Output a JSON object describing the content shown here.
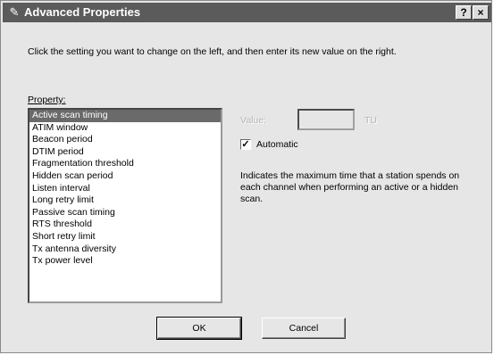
{
  "window": {
    "title": "Advanced Properties",
    "icon": "wrench-icon",
    "help_label": "?",
    "close_label": "×"
  },
  "instructions": "Click the setting you want to change on the left, and then enter its new value on the right.",
  "property": {
    "label": "Property:",
    "selected_index": 0,
    "items": [
      "Active scan timing",
      "ATIM window",
      "Beacon period",
      "DTIM period",
      "Fragmentation threshold",
      "Hidden scan period",
      "Listen interval",
      "Long retry limit",
      "Passive scan timing",
      "RTS threshold",
      "Short retry limit",
      "Tx antenna diversity",
      "Tx power level"
    ]
  },
  "value": {
    "label": "Value:",
    "input_value": "",
    "unit": "TU",
    "enabled": false
  },
  "automatic": {
    "label": "Automatic",
    "checked": true,
    "check_glyph": "✓"
  },
  "description": "Indicates the maximum time that a station spends on each channel when performing an active or a hidden scan.",
  "buttons": {
    "ok": "OK",
    "cancel": "Cancel"
  },
  "colors": {
    "dialog_background": "#e6e6e6",
    "titlebar": "#5b5b5b",
    "selection": "#6a6a6a",
    "disabled_text": "#b4b4b4"
  }
}
